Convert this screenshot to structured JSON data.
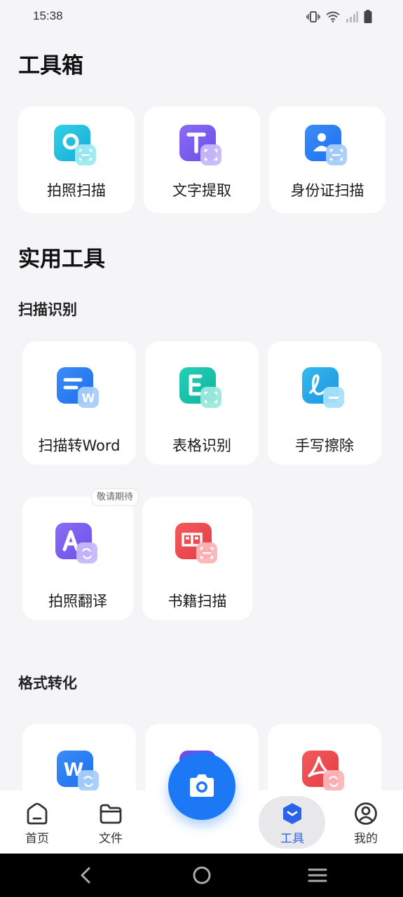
{
  "status": {
    "time": "15:38",
    "icons": [
      "vibrate-icon",
      "wifi-icon",
      "signal-icon",
      "battery-icon"
    ]
  },
  "toolbox": {
    "title": "工具箱",
    "items": [
      {
        "label": "拍照扫描",
        "icon": "camera-scan-icon"
      },
      {
        "label": "文字提取",
        "icon": "text-extract-icon"
      },
      {
        "label": "身份证扫描",
        "icon": "id-card-scan-icon"
      }
    ]
  },
  "practical": {
    "title": "实用工具",
    "scan_section": {
      "title": "扫描识别",
      "items": [
        {
          "label": "扫描转Word",
          "icon": "scan-to-word-icon"
        },
        {
          "label": "表格识别",
          "icon": "table-recognize-icon"
        },
        {
          "label": "手写擦除",
          "icon": "handwriting-erase-icon"
        },
        {
          "label": "拍照翻译",
          "icon": "photo-translate-icon",
          "badge": "敬请期待"
        },
        {
          "label": "书籍扫描",
          "icon": "book-scan-icon"
        }
      ]
    },
    "format_section": {
      "title": "格式转化",
      "items": [
        {
          "icon": "word-convert-icon"
        },
        {
          "icon": "image-convert-icon"
        },
        {
          "icon": "pdf-convert-icon"
        }
      ]
    }
  },
  "nav": {
    "items": [
      {
        "label": "首页",
        "icon": "home-icon"
      },
      {
        "label": "文件",
        "icon": "folder-icon"
      },
      {
        "label": "工具",
        "icon": "tools-icon",
        "active": true
      },
      {
        "label": "我的",
        "icon": "profile-icon"
      }
    ],
    "camera_icon": "camera-icon"
  },
  "colors": {
    "accent": "#1d78f5",
    "card_bg": "#ffffff",
    "page_bg": "#f5f5f7"
  }
}
